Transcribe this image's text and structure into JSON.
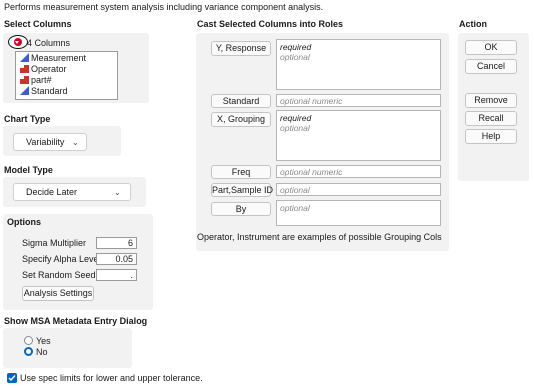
{
  "description": "Performs measurement system analysis including variance component analysis.",
  "select_columns": {
    "heading": "Select Columns",
    "columns_label": "4 Columns",
    "columns": [
      {
        "name": "Measurement",
        "icon": "continuous-icon",
        "color": "#3b5fc4"
      },
      {
        "name": "Operator",
        "icon": "nominal-icon",
        "color": "#c0392b"
      },
      {
        "name": "part#",
        "icon": "nominal-icon",
        "color": "#c0392b"
      },
      {
        "name": "Standard",
        "icon": "continuous-icon",
        "color": "#3b5fc4"
      }
    ]
  },
  "chart_type": {
    "heading": "Chart Type",
    "value": "Variability"
  },
  "model_type": {
    "heading": "Model Type",
    "value": "Decide Later"
  },
  "options": {
    "heading": "Options",
    "sigma_label": "Sigma Multiplier",
    "sigma_value": "6",
    "alpha_label": "Specify Alpha Level",
    "alpha_value": "0.05",
    "seed_label": "Set Random Seed",
    "seed_value": ".",
    "settings_button": "Analysis Settings"
  },
  "msa_metadata": {
    "heading": "Show MSA Metadata Entry Dialog",
    "yes": "Yes",
    "no": "No",
    "selected": "No"
  },
  "spec_limits": {
    "label": "Use spec limits for lower and upper tolerance.",
    "checked": true
  },
  "cast": {
    "heading": "Cast Selected Columns into Roles",
    "y_response": {
      "label": "Y, Response",
      "line1": "required",
      "line2": "optional"
    },
    "standard": {
      "label": "Standard",
      "placeholder": "optional numeric"
    },
    "x_grouping": {
      "label": "X, Grouping",
      "line1": "required",
      "line2": "optional"
    },
    "freq": {
      "label": "Freq",
      "placeholder": "optional numeric"
    },
    "part_sample": {
      "label": "Part,Sample ID",
      "placeholder": "optional"
    },
    "by": {
      "label": "By",
      "placeholder": "optional"
    },
    "footer": "Operator, Instrument are examples of possible Grouping Cols"
  },
  "action": {
    "heading": "Action",
    "ok": "OK",
    "cancel": "Cancel",
    "remove": "Remove",
    "recall": "Recall",
    "help": "Help"
  },
  "colors": {
    "accent": "#0067c0",
    "panel": "#f2f2f2",
    "red_disclosure": "#d0021b"
  }
}
